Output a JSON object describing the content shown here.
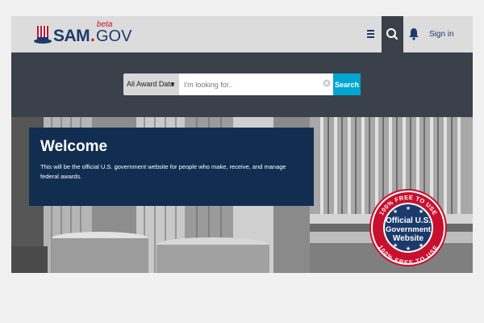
{
  "header": {
    "logo": {
      "brand": "SAM",
      "dot": ".",
      "tld": "GOV",
      "badge": "beta"
    },
    "menu_icon": "menu-icon",
    "search_icon": "search-icon",
    "bell_icon": "bell-icon",
    "signin_label": "Sign in"
  },
  "search": {
    "category_selected": "All Award Data",
    "placeholder": "I'm looking for..",
    "button_label": "Search"
  },
  "hero": {
    "title": "Welcome",
    "body": "This will be the official U.S. government website for people who make, receive, and manage federal awards."
  },
  "seal": {
    "ring_text_top": "100% FREE TO USE",
    "ring_text_bottom": "100% FREE TO USE",
    "line1": "Official U.S.",
    "line2": "Government",
    "line3": "Website"
  },
  "colors": {
    "navy": "#112e51",
    "header_bg": "#dcdcdc",
    "band_bg": "#3a414a",
    "search_button": "#00a6d2",
    "brand_red": "#c8102e"
  }
}
